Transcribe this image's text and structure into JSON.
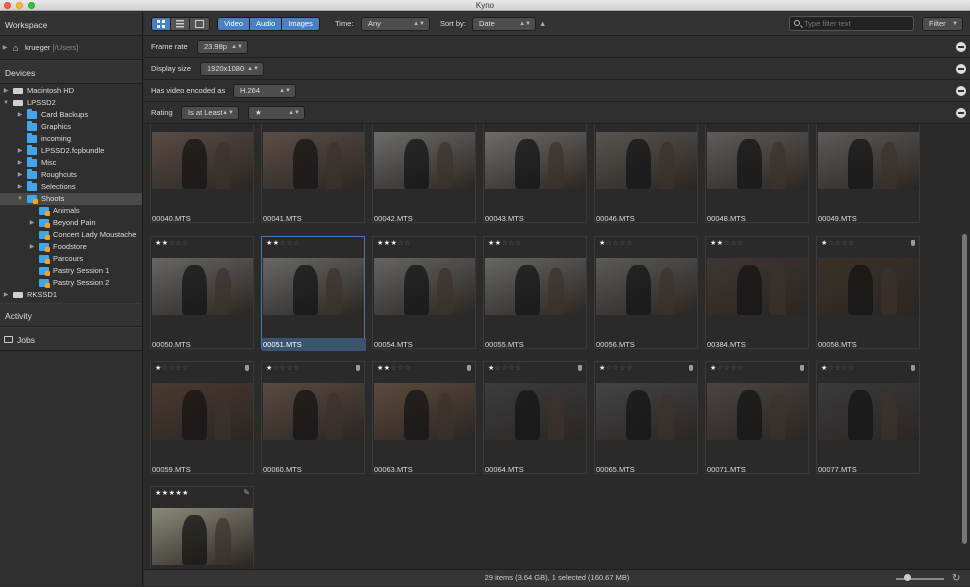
{
  "window": {
    "title": "Kyno"
  },
  "sidebar": {
    "workspace": "Workspace",
    "user": "krueger",
    "user_path": "[/Users]",
    "devices": "Devices",
    "tree": [
      {
        "label": "Macintosh HD",
        "type": "drive",
        "indent": 0,
        "disc": "▶"
      },
      {
        "label": "LPSSD2",
        "type": "drive",
        "indent": 0,
        "disc": "▼"
      },
      {
        "label": "Card Backups",
        "type": "folder",
        "indent": 1,
        "disc": "▶"
      },
      {
        "label": "Graphics",
        "type": "folder",
        "indent": 1,
        "disc": ""
      },
      {
        "label": "incoming",
        "type": "folder",
        "indent": 1,
        "disc": ""
      },
      {
        "label": "LPSSD2.fcpbundle",
        "type": "folder",
        "indent": 1,
        "disc": "▶"
      },
      {
        "label": "Misc",
        "type": "folder",
        "indent": 1,
        "disc": "▶"
      },
      {
        "label": "Roughcuts",
        "type": "folder",
        "indent": 1,
        "disc": "▶"
      },
      {
        "label": "Selections",
        "type": "folder",
        "indent": 1,
        "disc": "▶"
      },
      {
        "label": "Shoots",
        "type": "shoot",
        "indent": 1,
        "disc": "▼",
        "selected": true
      },
      {
        "label": "Animals",
        "type": "shoot",
        "indent": 2,
        "disc": ""
      },
      {
        "label": "Beyond Pain",
        "type": "shoot",
        "indent": 2,
        "disc": "▶"
      },
      {
        "label": "Concert Lady Moustache",
        "type": "shoot",
        "indent": 2,
        "disc": ""
      },
      {
        "label": "Foodstore",
        "type": "shoot",
        "indent": 2,
        "disc": "▶"
      },
      {
        "label": "Parcours",
        "type": "shoot",
        "indent": 2,
        "disc": ""
      },
      {
        "label": "Pastry Session 1",
        "type": "shoot",
        "indent": 2,
        "disc": ""
      },
      {
        "label": "Pastry Session 2",
        "type": "shoot",
        "indent": 2,
        "disc": ""
      },
      {
        "label": "RKSSD1",
        "type": "drive",
        "indent": 0,
        "disc": "▶"
      }
    ],
    "activity": "Activity",
    "jobs": "Jobs"
  },
  "toolbar": {
    "media_types": [
      "Video",
      "Audio",
      "Images"
    ],
    "time_label": "Time:",
    "time_value": "Any",
    "sort_label": "Sort by:",
    "sort_value": "Date",
    "sort_dir": "▲",
    "search_placeholder": "Type filter text",
    "filter_button": "Filter"
  },
  "filters": [
    {
      "label": "Frame rate",
      "value": "23.98p"
    },
    {
      "label": "Display size",
      "value": "1920x1080"
    },
    {
      "label": "Has video encoded as",
      "value": "H.264"
    },
    {
      "label": "Rating",
      "op": "Is at Least",
      "value": "★"
    }
  ],
  "clips": [
    {
      "name": "00040.MTS",
      "stars": 0,
      "bg": "#5a4c44",
      "tagged": false,
      "show_stars": false
    },
    {
      "name": "00041.MTS",
      "stars": 0,
      "bg": "#5c4e46",
      "tagged": false,
      "show_stars": false
    },
    {
      "name": "00042.MTS",
      "stars": 0,
      "bg": "#6c6c6a",
      "tagged": false,
      "show_stars": false
    },
    {
      "name": "00043.MTS",
      "stars": 0,
      "bg": "#6e6c6a",
      "tagged": false,
      "show_stars": false
    },
    {
      "name": "00046.MTS",
      "stars": 0,
      "bg": "#585450",
      "tagged": false,
      "show_stars": false
    },
    {
      "name": "00048.MTS",
      "stars": 0,
      "bg": "#5e5c5a",
      "tagged": false,
      "show_stars": false
    },
    {
      "name": "00049.MTS",
      "stars": 0,
      "bg": "#5c5a58",
      "tagged": false,
      "show_stars": false
    },
    {
      "name": "00050.MTS",
      "stars": 2,
      "bg": "#666664",
      "tagged": false,
      "show_stars": true
    },
    {
      "name": "00051.MTS",
      "stars": 2,
      "bg": "#686866",
      "tagged": false,
      "show_stars": true,
      "selected": true
    },
    {
      "name": "00054.MTS",
      "stars": 3,
      "bg": "#646462",
      "tagged": false,
      "show_stars": true
    },
    {
      "name": "00055.MTS",
      "stars": 2,
      "bg": "#666664",
      "tagged": false,
      "show_stars": true
    },
    {
      "name": "00056.MTS",
      "stars": 1,
      "bg": "#5a5a58",
      "tagged": false,
      "show_stars": true
    },
    {
      "name": "00384.MTS",
      "stars": 2,
      "bg": "#3e3632",
      "tagged": false,
      "show_stars": true
    },
    {
      "name": "00058.MTS",
      "stars": 1,
      "bg": "#3a3228",
      "tagged": true,
      "show_stars": true
    },
    {
      "name": "00059.MTS",
      "stars": 1,
      "bg": "#4a3a30",
      "tagged": true,
      "show_stars": true
    },
    {
      "name": "00060.MTS",
      "stars": 1,
      "bg": "#5a4a40",
      "tagged": true,
      "show_stars": true
    },
    {
      "name": "00063.MTS",
      "stars": 2,
      "bg": "#5c4a3c",
      "tagged": true,
      "show_stars": true
    },
    {
      "name": "00064.MTS",
      "stars": 1,
      "bg": "#3c3c3e",
      "tagged": true,
      "show_stars": true
    },
    {
      "name": "00065.MTS",
      "stars": 1,
      "bg": "#444446",
      "tagged": true,
      "show_stars": true
    },
    {
      "name": "00071.MTS",
      "stars": 1,
      "bg": "#4a4442",
      "tagged": true,
      "show_stars": true
    },
    {
      "name": "00077.MTS",
      "stars": 1,
      "bg": "#3a3a3c",
      "tagged": true,
      "show_stars": true
    },
    {
      "name": "",
      "stars": 5,
      "bg": "#8a8a78",
      "tagged": false,
      "show_stars": true,
      "pencil": true
    }
  ],
  "status": {
    "text": "29 items (3.64 GB), 1 selected (160.67 MB)"
  }
}
